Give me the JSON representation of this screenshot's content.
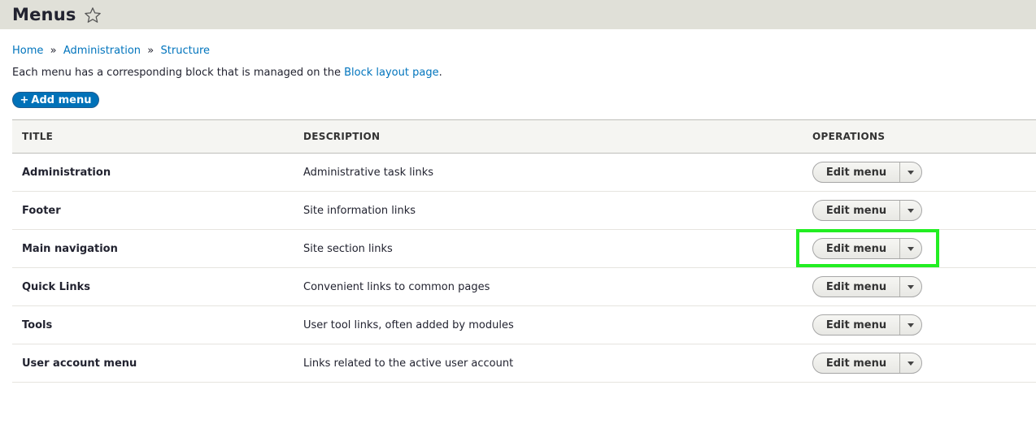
{
  "header": {
    "title": "Menus",
    "star_icon": "star-outline-icon"
  },
  "breadcrumb": {
    "items": [
      "Home",
      "Administration",
      "Structure"
    ],
    "separator": "»"
  },
  "help": {
    "before": "Each menu has a corresponding block that is managed on the ",
    "link": "Block layout page",
    "after": "."
  },
  "add_button": {
    "plus": "+",
    "label": "Add menu"
  },
  "table": {
    "headers": [
      "Title",
      "Description",
      "Operations"
    ],
    "rows": [
      {
        "title": "Administration",
        "description": "Administrative task links",
        "operation": "Edit menu"
      },
      {
        "title": "Footer",
        "description": "Site information links",
        "operation": "Edit menu"
      },
      {
        "title": "Main navigation",
        "description": "Site section links",
        "operation": "Edit menu"
      },
      {
        "title": "Quick Links",
        "description": "Convenient links to common pages",
        "operation": "Edit menu"
      },
      {
        "title": "Tools",
        "description": "User tool links, often added by modules",
        "operation": "Edit menu"
      },
      {
        "title": "User account menu",
        "description": "Links related to the active user account",
        "operation": "Edit menu"
      }
    ]
  },
  "colors": {
    "link": "#0074bd",
    "primary_button": "#0071b8",
    "header_bg": "#e0e0d8",
    "highlight": "#22ee22"
  }
}
